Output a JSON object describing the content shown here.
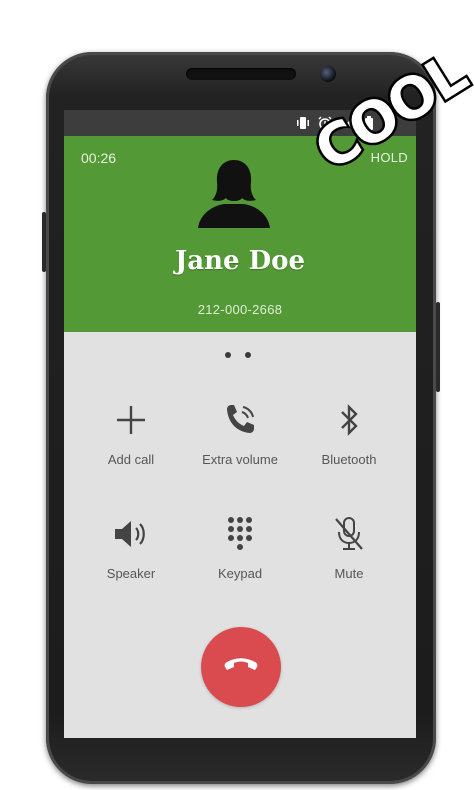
{
  "status_bar": {
    "icons": [
      "vibrate-icon",
      "alarm-icon",
      "signal-icon",
      "battery-icon"
    ]
  },
  "call": {
    "timer": "00:26",
    "hold_label": "HOLD",
    "contact_name": "Jane Doe",
    "phone_number": "212-000-2668"
  },
  "controls": [
    {
      "label": "Add call",
      "icon": "plus-icon"
    },
    {
      "label": "Extra volume",
      "icon": "phone-volume-icon"
    },
    {
      "label": "Bluetooth",
      "icon": "bluetooth-icon"
    },
    {
      "label": "Speaker",
      "icon": "speaker-icon"
    },
    {
      "label": "Keypad",
      "icon": "keypad-icon"
    },
    {
      "label": "Mute",
      "icon": "mic-off-icon"
    }
  ],
  "end_call": {
    "icon": "end-call-icon"
  },
  "badge": {
    "text": "COOL"
  },
  "colors": {
    "header_green": "#539935",
    "end_call_red": "#d94b4f",
    "screen_bg": "#e1e1e1"
  }
}
